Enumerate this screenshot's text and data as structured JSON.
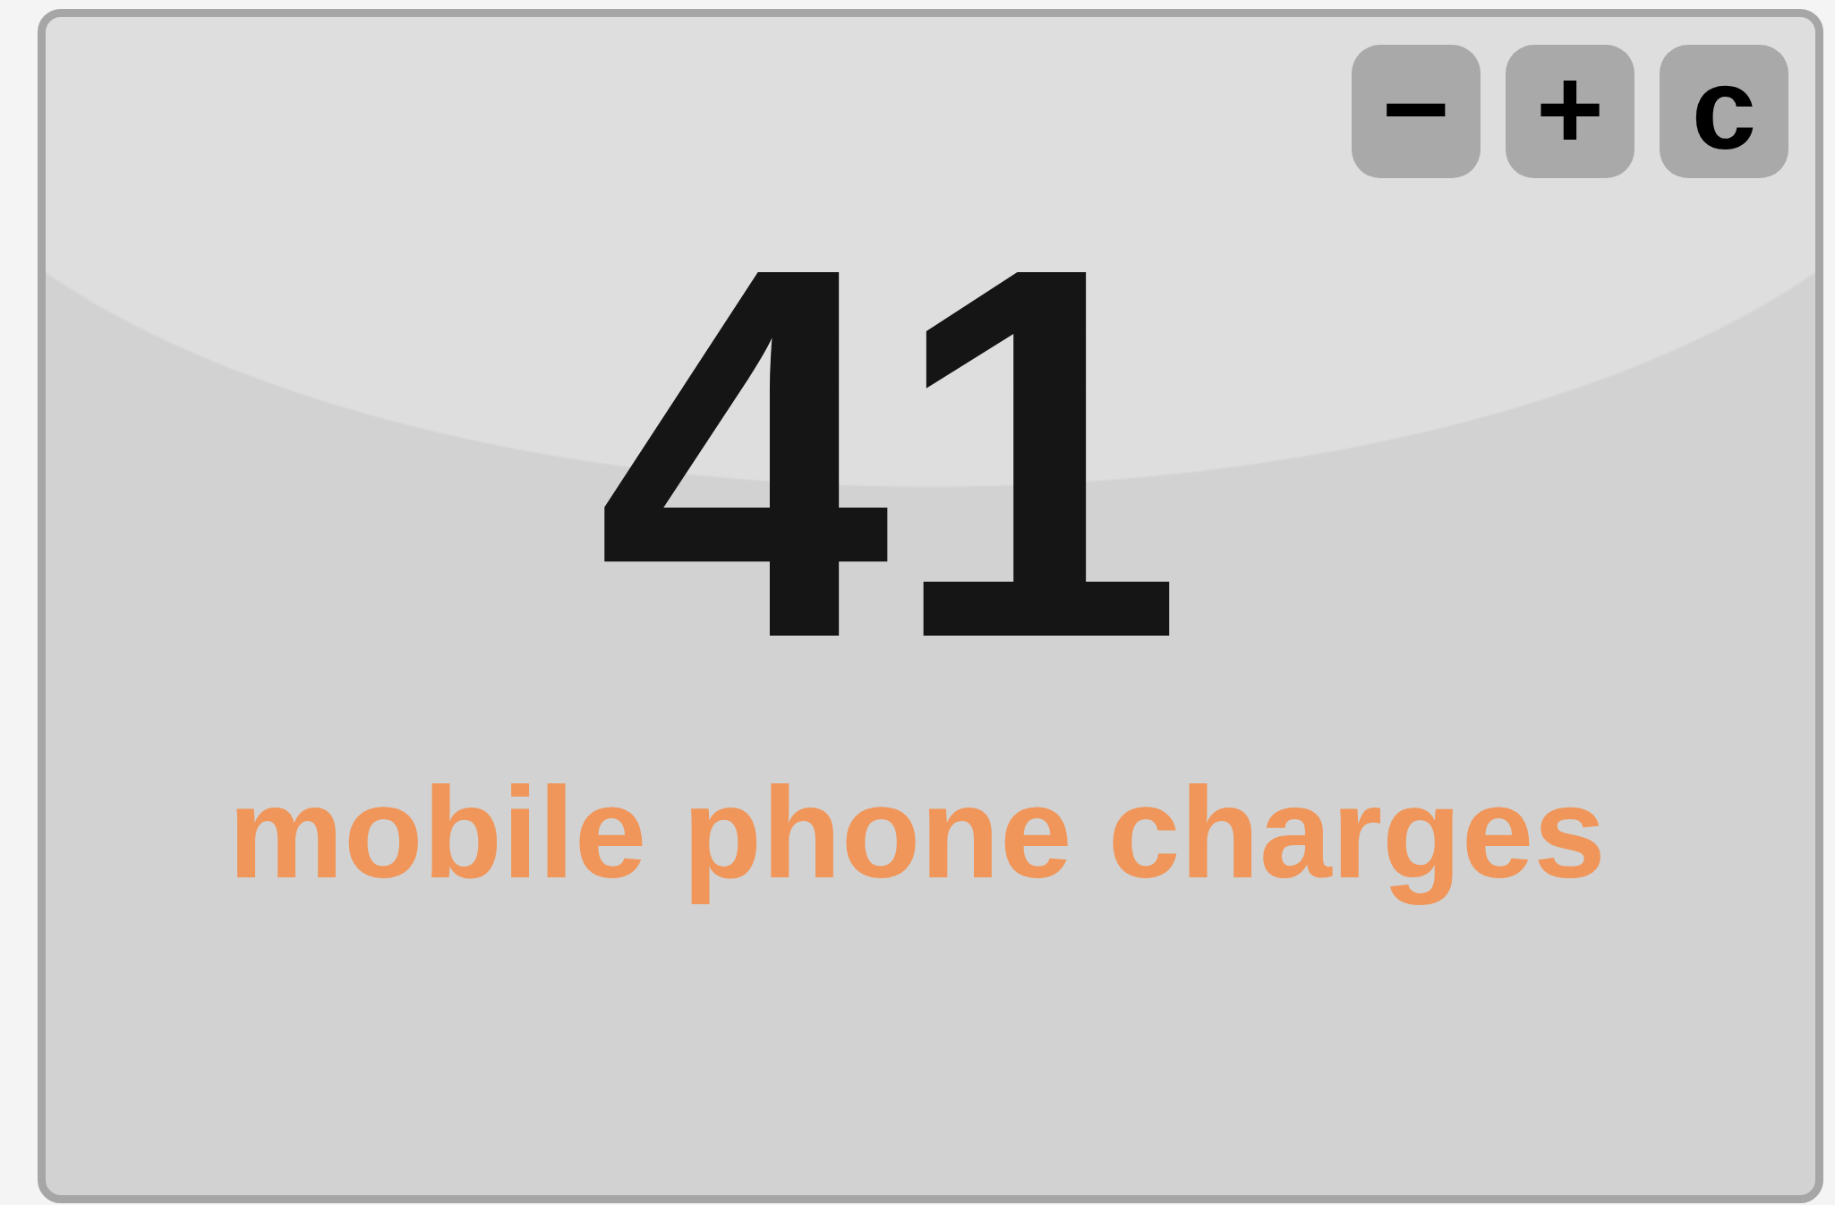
{
  "buttons": [
    {
      "label": "−"
    },
    {
      "label": "+"
    },
    {
      "label": "c"
    }
  ],
  "counter": {
    "value": "41",
    "label": "mobile phone charges"
  }
}
